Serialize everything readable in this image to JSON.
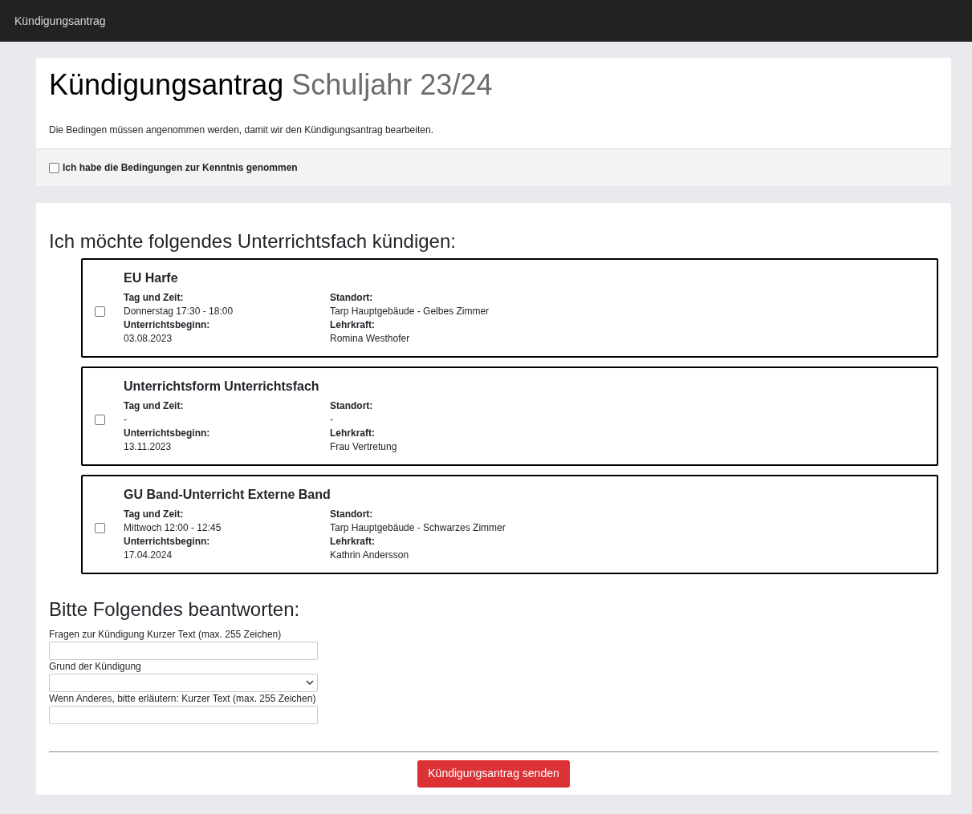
{
  "navbar": {
    "title": "Kündigungsantrag"
  },
  "header": {
    "title": "Kündigungsantrag",
    "subtitle": "Schuljahr 23/24",
    "notice": "Die Bedingen müssen angenommen werden, damit wir den Kündigungsantrag bearbeiten.",
    "terms": {
      "label": "Ich habe die Bedingungen zur Kenntnis genommen",
      "checked": false
    }
  },
  "subjects_heading": "Ich möchte folgendes Unterrichtsfach kündigen:",
  "subjects": [
    {
      "name": "EU Harfe",
      "checked": false,
      "fields": [
        {
          "label": "Tag und Zeit:",
          "value": "Donnerstag 17:30 - 18:00"
        },
        {
          "label": "Standort:",
          "value": "Tarp Hauptgebäude - Gelbes Zimmer"
        },
        {
          "label": "Unterrichtsbeginn:",
          "value": "03.08.2023"
        },
        {
          "label": "Lehrkraft:",
          "value": "Romina Westhofer"
        }
      ]
    },
    {
      "name": "Unterrichtsform Unterrichtsfach",
      "checked": false,
      "fields": [
        {
          "label": "Tag und Zeit:",
          "value": "-"
        },
        {
          "label": "Standort:",
          "value": "-"
        },
        {
          "label": "Unterrichtsbeginn:",
          "value": "13.11.2023"
        },
        {
          "label": "Lehrkraft:",
          "value": "Frau Vertretung"
        }
      ]
    },
    {
      "name": "GU Band-Unterricht Externe Band",
      "checked": false,
      "fields": [
        {
          "label": "Tag und Zeit:",
          "value": "Mittwoch 12:00 - 12:45"
        },
        {
          "label": "Standort:",
          "value": "Tarp Hauptgebäude - Schwarzes Zimmer"
        },
        {
          "label": "Unterrichtsbeginn:",
          "value": "17.04.2024"
        },
        {
          "label": "Lehrkraft:",
          "value": "Kathrin Andersson"
        }
      ]
    }
  ],
  "questions_heading": "Bitte Folgendes beantworten:",
  "questions": [
    {
      "kind": "text",
      "label": "Fragen zur Kündigung Kurzer Text (max. 255 Zeichen)"
    },
    {
      "kind": "select",
      "label": "Grund der Kündigung"
    },
    {
      "kind": "text",
      "label": "Wenn Anderes, bitte erläutern: Kurzer Text (max. 255 Zeichen)"
    }
  ],
  "submit_button": "Kündigungsantrag senden"
}
